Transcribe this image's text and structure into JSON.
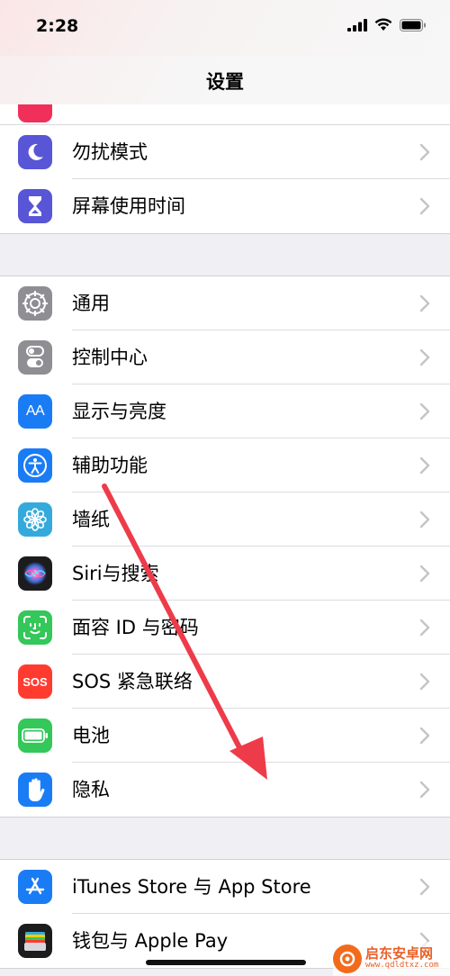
{
  "status": {
    "time": "2:28"
  },
  "nav": {
    "title": "设置"
  },
  "groups": [
    {
      "items": [
        {
          "label": "勿扰模式",
          "icon": "moon-icon",
          "color": "#5856d6"
        },
        {
          "label": "屏幕使用时间",
          "icon": "hourglass-icon",
          "color": "#5856d6"
        }
      ]
    },
    {
      "items": [
        {
          "label": "通用",
          "icon": "gear-icon",
          "color": "#8e8e93"
        },
        {
          "label": "控制中心",
          "icon": "toggles-icon",
          "color": "#8e8e93"
        },
        {
          "label": "显示与亮度",
          "icon": "text-size-icon",
          "color": "#1a7cf5"
        },
        {
          "label": "辅助功能",
          "icon": "accessibility-icon",
          "color": "#1a7cf5"
        },
        {
          "label": "墙纸",
          "icon": "flower-icon",
          "color": "#34aadc"
        },
        {
          "label": "Siri与搜索",
          "icon": "siri-icon",
          "color": "#222222"
        },
        {
          "label": "面容 ID 与密码",
          "icon": "face-id-icon",
          "color": "#34c759"
        },
        {
          "label": "SOS 紧急联络",
          "icon": "sos-icon",
          "color": "#ff3b30"
        },
        {
          "label": "电池",
          "icon": "battery-icon",
          "color": "#34c759"
        },
        {
          "label": "隐私",
          "icon": "hand-icon",
          "color": "#1a7cf5"
        }
      ]
    },
    {
      "items": [
        {
          "label": "iTunes Store 与 App Store",
          "icon": "app-store-icon",
          "color": "#1a7cf5"
        },
        {
          "label": "钱包与 Apple Pay",
          "icon": "wallet-icon",
          "color": "#222222"
        }
      ]
    }
  ],
  "sos_icon_text": "SOS",
  "text_size_icon_text": "AA",
  "watermark": {
    "name": "启东安卓网",
    "url": "www.qdldtxz.com"
  },
  "annotation_color": "#ee3b4a"
}
